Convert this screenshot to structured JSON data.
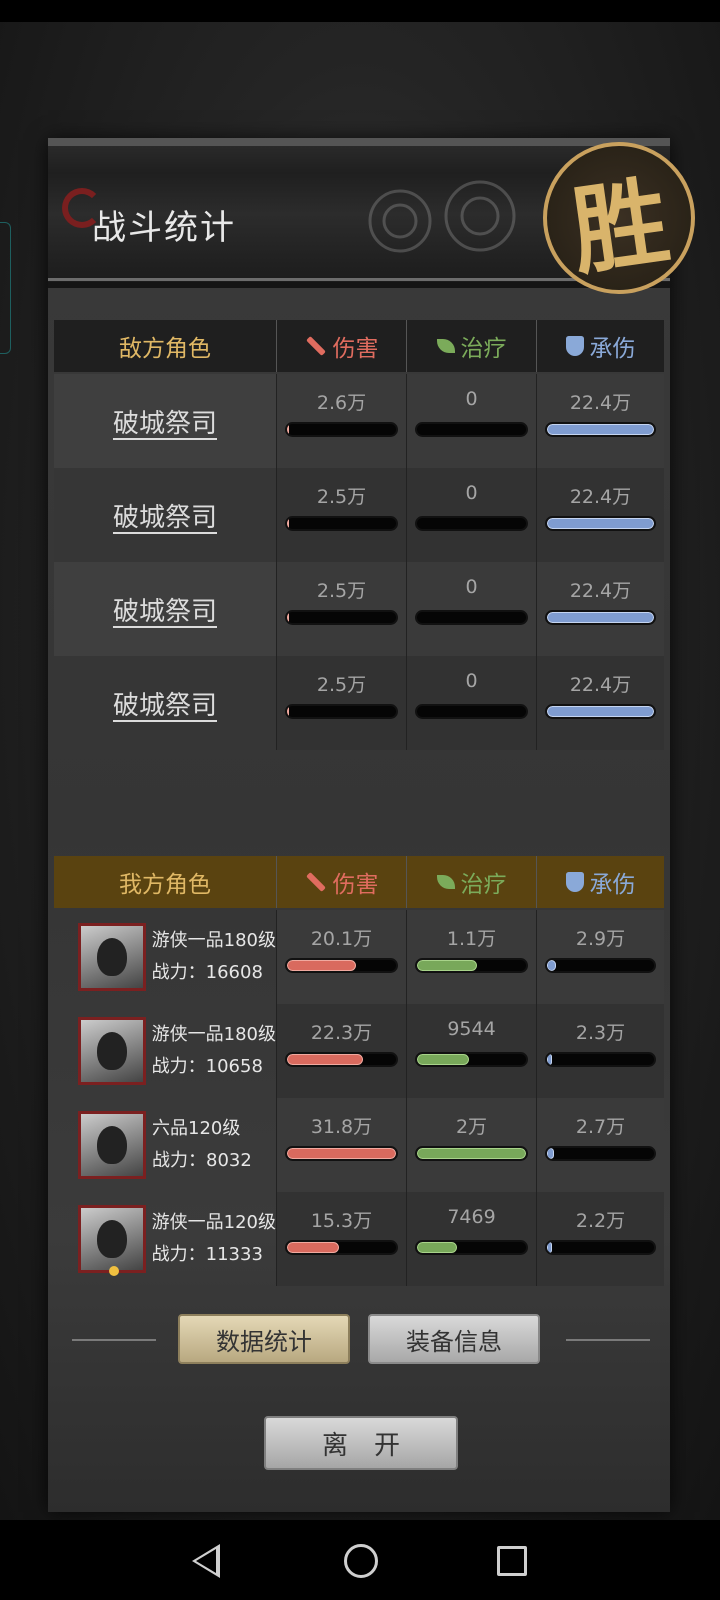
{
  "header": {
    "title": "战斗统计",
    "result_badge": "胜"
  },
  "columns": {
    "damage": "伤害",
    "heal": "治疗",
    "tank": "承伤"
  },
  "enemy": {
    "header": "敌方角色",
    "rows": [
      {
        "name": "破城祭司",
        "damage": "2.6万",
        "heal": "0",
        "tank": "22.4万",
        "damage_pct": 0.02,
        "heal_pct": 0,
        "tank_pct": 1.0
      },
      {
        "name": "破城祭司",
        "damage": "2.5万",
        "heal": "0",
        "tank": "22.4万",
        "damage_pct": 0.02,
        "heal_pct": 0,
        "tank_pct": 1.0
      },
      {
        "name": "破城祭司",
        "damage": "2.5万",
        "heal": "0",
        "tank": "22.4万",
        "damage_pct": 0.02,
        "heal_pct": 0,
        "tank_pct": 1.0
      },
      {
        "name": "破城祭司",
        "damage": "2.5万",
        "heal": "0",
        "tank": "22.4万",
        "damage_pct": 0.02,
        "heal_pct": 0,
        "tank_pct": 1.0
      }
    ]
  },
  "ally": {
    "header": "我方角色",
    "rows": [
      {
        "rank": "游侠一品180级",
        "power": "战力：16608",
        "damage": "20.1万",
        "heal": "1.1万",
        "tank": "2.9万",
        "damage_pct": 0.63,
        "heal_pct": 0.55,
        "tank_pct": 0.08
      },
      {
        "rank": "游侠一品180级",
        "power": "战力：10658",
        "damage": "22.3万",
        "heal": "9544",
        "tank": "2.3万",
        "damage_pct": 0.7,
        "heal_pct": 0.48,
        "tank_pct": 0.05
      },
      {
        "rank": "六品120级",
        "power": "战力：8032",
        "damage": "31.8万",
        "heal": "2万",
        "tank": "2.7万",
        "damage_pct": 1.0,
        "heal_pct": 1.0,
        "tank_pct": 0.07
      },
      {
        "rank": "游侠一品120级",
        "power": "战力：11333",
        "damage": "15.3万",
        "heal": "7469",
        "tank": "2.2万",
        "damage_pct": 0.48,
        "heal_pct": 0.37,
        "tank_pct": 0.05
      }
    ]
  },
  "buttons": {
    "stats": "数据统计",
    "equip": "装备信息",
    "leave": "离开"
  },
  "colors": {
    "damage": "#d96a5e",
    "heal": "#78a85a",
    "tank": "#7f9cd0",
    "accent_gold": "#e0b865"
  },
  "icons": {
    "damage": "sword-icon",
    "heal": "leaf-icon",
    "tank": "shield-icon"
  }
}
